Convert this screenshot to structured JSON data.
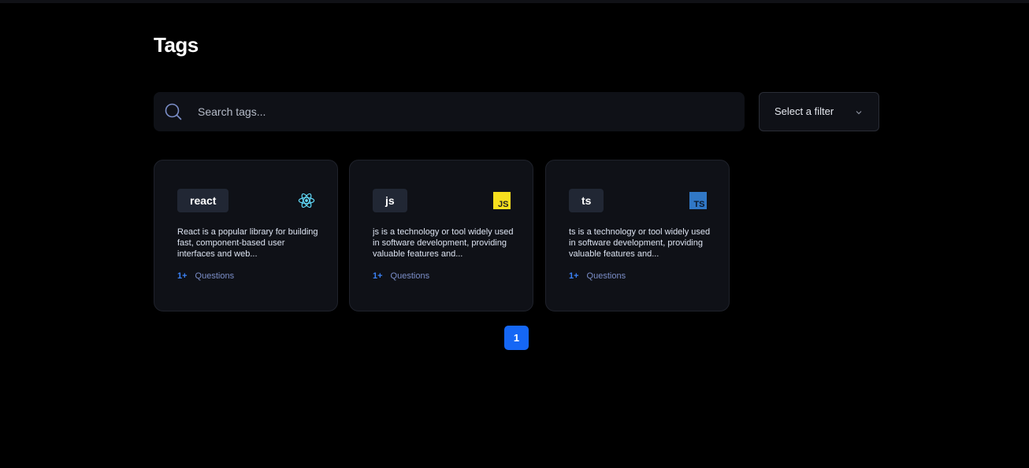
{
  "header": {
    "title": "Tags"
  },
  "search": {
    "placeholder": "Search tags..."
  },
  "filter": {
    "label": "Select a filter"
  },
  "tags": [
    {
      "name": "react",
      "icon": "react-icon",
      "description": "React is a popular library for building fast, component-based user interfaces and web...",
      "count": "1+",
      "count_label": "Questions"
    },
    {
      "name": "js",
      "icon": "javascript-icon",
      "description": "js is a technology or tool widely used in software development, providing valuable features and...",
      "count": "1+",
      "count_label": "Questions"
    },
    {
      "name": "ts",
      "icon": "typescript-icon",
      "description": "ts is a technology or tool widely used in software development, providing valuable features and...",
      "count": "1+",
      "count_label": "Questions"
    }
  ],
  "pagination": {
    "current": "1"
  },
  "colors": {
    "background": "#000000",
    "card": "#0f1117",
    "chip": "#212734",
    "accent": "#1567f5",
    "count": "#3b82f6",
    "react": "#61dafb",
    "javascript": "#f7df1e",
    "typescript": "#3178c6"
  }
}
